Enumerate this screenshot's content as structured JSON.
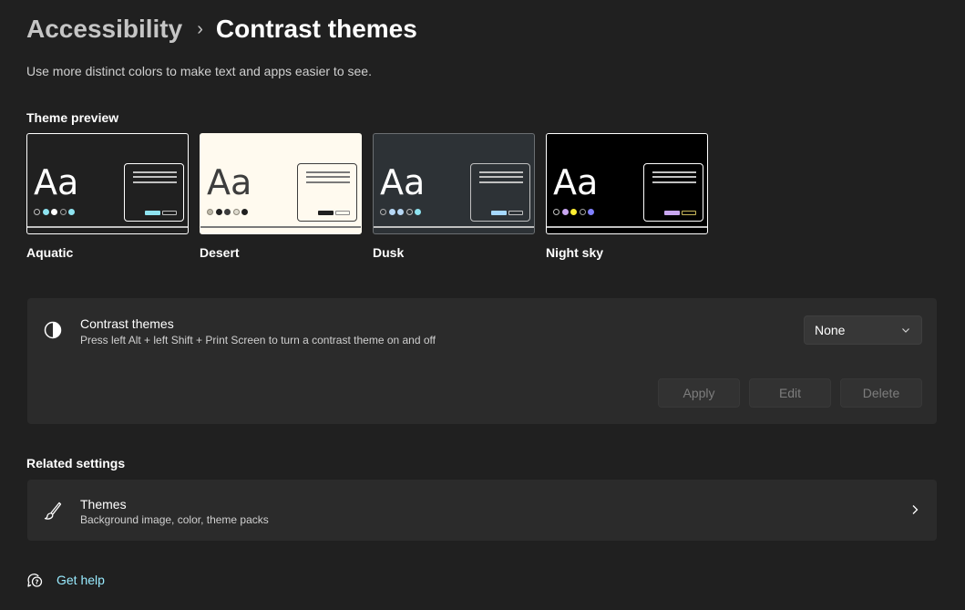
{
  "breadcrumb": {
    "parent": "Accessibility",
    "separator": "›",
    "current": "Contrast themes"
  },
  "description": "Use more distinct colors to make text and apps easier to see.",
  "theme_preview": {
    "heading": "Theme preview",
    "themes": [
      {
        "name": "Aquatic",
        "preview_text": "Aa",
        "background": "#202020",
        "border": "#ffffff",
        "text_color": "#ffffff",
        "dots": [
          "#202020",
          "#8ee3f0",
          "#ffffff",
          "#202020",
          "#8ee3f0"
        ],
        "dot_borders": [
          "#c0c0c0",
          "#8ee3f0",
          "#ffffff",
          "#a0a0a0",
          "#8ee3f0"
        ],
        "window_border": "#ffffff",
        "window_lines": "#c0c0c0",
        "button1": "#8ee3f0",
        "button2": "#c0c0c0",
        "taskbar": "#c0c0c0"
      },
      {
        "name": "Desert",
        "preview_text": "Aa",
        "background": "#fffaef",
        "border": "#fffaef",
        "text_color": "#3d3d3d",
        "dots": [
          "#bdb8a8",
          "#202020",
          "#3d3d3d",
          "#e0dcd0",
          "#202020"
        ],
        "dot_borders": [
          "#8a8578",
          "#202020",
          "#3d3d3d",
          "#8a8578",
          "#202020"
        ],
        "window_border": "#3d3d3d",
        "window_lines": "#7a7a7a",
        "button1": "#202020",
        "button2": "#8a8a8a",
        "taskbar": "#7a7a7a"
      },
      {
        "name": "Dusk",
        "preview_text": "Aa",
        "background": "#2d3236",
        "border": "#6b6f72",
        "text_color": "#ffffff",
        "dots": [
          "#2d3236",
          "#b6d7f5",
          "#b6d7f5",
          "#2d3236",
          "#8ee3f0"
        ],
        "dot_borders": [
          "#b0b0b0",
          "#b6d7f5",
          "#b6d7f5",
          "#c0c0c0",
          "#8ee3f0"
        ],
        "window_border": "#c0c0c0",
        "window_lines": "#c0c0c0",
        "button1": "#a6d8ff",
        "button2": "#c0c0c0",
        "taskbar": "#c0c0c0"
      },
      {
        "name": "Night sky",
        "preview_text": "Aa",
        "background": "#000000",
        "border": "#ffffff",
        "text_color": "#ffffff",
        "dots": [
          "#000000",
          "#c8a6f0",
          "#ffee32",
          "#000000",
          "#8080ff"
        ],
        "dot_borders": [
          "#c0c0c0",
          "#c8a6f0",
          "#ffee32",
          "#a0a0a0",
          "#8080ff"
        ],
        "window_border": "#ffffff",
        "window_lines": "#c0c0c0",
        "button1": "#c8a6f0",
        "button2": "#c8b75a",
        "taskbar": "#c0c0c0"
      }
    ]
  },
  "contrast_setting": {
    "icon": "contrast-icon",
    "title": "Contrast themes",
    "subtitle": "Press left Alt + left Shift + Print Screen to turn a contrast theme on and off",
    "dropdown_value": "None",
    "buttons": {
      "apply": "Apply",
      "edit": "Edit",
      "delete": "Delete"
    }
  },
  "related": {
    "heading": "Related settings",
    "themes": {
      "icon": "brush-icon",
      "title": "Themes",
      "subtitle": "Background image, color, theme packs"
    }
  },
  "help": {
    "icon": "help-icon",
    "label": "Get help",
    "link_color": "#99ebff"
  },
  "colors": {
    "background": "#202020",
    "card": "#2b2b2b",
    "accent_link": "#99ebff"
  }
}
